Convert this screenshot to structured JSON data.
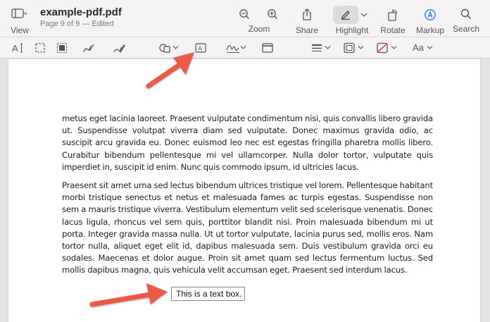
{
  "window": {
    "doc_title": "example-pdf.pdf",
    "doc_subtitle": "Page 9 of 9 — Edited",
    "view_label": "View"
  },
  "toolbar": {
    "zoom_label": "Zoom",
    "share_label": "Share",
    "highlight_label": "Highlight",
    "rotate_label": "Rotate",
    "markup_label": "Markup",
    "search_label": "Search"
  },
  "markup_bar": {
    "font_button_label": "Aa"
  },
  "document": {
    "paragraph_1": "metus eget lacinia laoreet. Praesent vulputate condimentum nisi, quis convallis libero gravida ut. Suspendisse volutpat viverra diam sed vulputate. Donec maximus gravida odio, ac suscipit arcu gravida eu. Donec euismod leo nec est egestas fringilla pharetra mollis libero. Curabitur bibendum pellentesque mi vel ullamcorper. Nulla dolor tortor, vulputate quis imperdiet in, suscipit id enim. Nunc quis commodo ipsum, id ultricies lacus.",
    "paragraph_2": "Praesent sit amet urna sed lectus bibendum ultrices tristique vel lorem. Pellentesque habitant morbi tristique senectus et netus et malesuada fames ac turpis egestas. Suspendisse non sem a mauris tristique viverra. Vestibulum elementum velit sed scelerisque venenatis. Donec lacus ligula, rhoncus vel sem quis, porttitor blandit nisi. Proin malesuada bibendum mi ut porta. Integer gravida massa nulla. Ut ut tortor vulputate, lacinia purus sed, mollis eros. Nam tortor nulla, aliquet eget elit id, dapibus malesuada sem. Duis vestibulum gravida orci eu sodales. Maecenas et dolor augue. Proin sit amet quam sed lectus fermentum luctus. Sed mollis dapibus magna, quis vehicula velit accumsan eget. Praesent sed interdum lacus.",
    "text_box": "This is a text box."
  },
  "colors": {
    "accent_blue": "#2f7cf6",
    "annotation_arrow": "#ec5a47"
  }
}
